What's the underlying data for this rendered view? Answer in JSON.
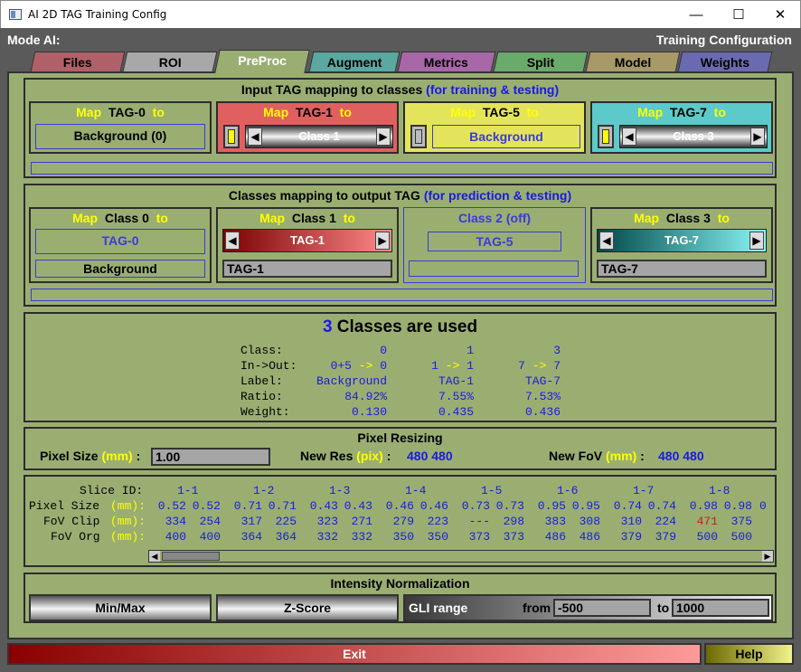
{
  "window": {
    "title": "AI 2D TAG Training Config",
    "min": "—",
    "max": "☐",
    "close": "✕"
  },
  "header": {
    "mode": "Mode AI:",
    "right": "Training Configuration"
  },
  "tabs": [
    {
      "label": "Files",
      "color": "#b06068"
    },
    {
      "label": "ROI",
      "color": "#a8a8a8"
    },
    {
      "label": "PreProc",
      "color": "#9aae72"
    },
    {
      "label": "Augment",
      "color": "#5aa8a0"
    },
    {
      "label": "Metrics",
      "color": "#a868a8"
    },
    {
      "label": "Split",
      "color": "#6aaa6a"
    },
    {
      "label": "Model",
      "color": "#a89a68"
    },
    {
      "label": "Weights",
      "color": "#6a6ab0"
    }
  ],
  "input_map": {
    "title": "Input TAG mapping to classes",
    "title_note": "(for training & testing)",
    "cells": [
      {
        "map": "Map",
        "tag": "TAG-0",
        "to": "to",
        "value": "Background (0)"
      },
      {
        "map": "Map",
        "tag": "TAG-1",
        "to": "to",
        "value": "Class 1"
      },
      {
        "map": "Map",
        "tag": "TAG-5",
        "to": "to",
        "value": "Background"
      },
      {
        "map": "Map",
        "tag": "TAG-7",
        "to": "to",
        "value": "Class 3"
      }
    ]
  },
  "output_map": {
    "title": "Classes mapping to output TAG",
    "title_note": "(for prediction & testing)",
    "cells": [
      {
        "map": "Map",
        "cls": "Class 0",
        "to": "to",
        "tag": "TAG-0",
        "label": "Background"
      },
      {
        "map": "Map",
        "cls": "Class 1",
        "to": "to",
        "tag": "TAG-1",
        "label": "TAG-1"
      },
      {
        "cls": "Class 2 (off)",
        "tag": "TAG-5",
        "label": ""
      },
      {
        "map": "Map",
        "cls": "Class 3",
        "to": "to",
        "tag": "TAG-7",
        "label": "TAG-7"
      }
    ]
  },
  "summary": {
    "count": "3",
    "count_text": "Classes are used",
    "row_labels": [
      "Class:",
      "In->Out:",
      "Label:",
      "Ratio:",
      "Weight:"
    ],
    "columns": [
      {
        "class": "0",
        "inout": "0+5 -> 0",
        "label": "Background",
        "ratio": "84.92%",
        "weight": "0.130"
      },
      {
        "class": "1",
        "inout": "1 -> 1",
        "label": "TAG-1",
        "ratio": "7.55%",
        "weight": "0.435"
      },
      {
        "class": "3",
        "inout": "7 -> 7",
        "label": "TAG-7",
        "ratio": "7.53%",
        "weight": "0.436"
      }
    ]
  },
  "resizing": {
    "title": "Pixel Resizing",
    "pixel_size_label": "Pixel Size",
    "mm": "(mm)",
    "colon": ":",
    "pixel_size_value": "1.00",
    "new_res_label": "New Res",
    "pix": "(pix)",
    "new_res_value": "480 480",
    "new_fov_label": "New FoV",
    "new_fov_value": "480 480"
  },
  "slices": {
    "row_labels": [
      "Slice ID:",
      "Pixel Size",
      "FoV Clip",
      "FoV Org"
    ],
    "mm": "(mm):",
    "ids": [
      "1-1",
      "1-2",
      "1-3",
      "1-4",
      "1-5",
      "1-6",
      "1-7",
      "1-8"
    ],
    "pixel_size": [
      [
        "0.52",
        "0.52"
      ],
      [
        "0.71",
        "0.71"
      ],
      [
        "0.43",
        "0.43"
      ],
      [
        "0.46",
        "0.46"
      ],
      [
        "0.73",
        "0.73"
      ],
      [
        "0.95",
        "0.95"
      ],
      [
        "0.74",
        "0.74"
      ],
      [
        "0.98",
        "0.98"
      ]
    ],
    "fov_clip": [
      [
        "334",
        "254"
      ],
      [
        "317",
        "225"
      ],
      [
        "323",
        "271"
      ],
      [
        "279",
        "223"
      ],
      [
        "---",
        "298"
      ],
      [
        "383",
        "308"
      ],
      [
        "310",
        "224"
      ],
      [
        "471",
        "375"
      ]
    ],
    "fov_org": [
      [
        "400",
        "400"
      ],
      [
        "364",
        "364"
      ],
      [
        "332",
        "332"
      ],
      [
        "350",
        "350"
      ],
      [
        "373",
        "373"
      ],
      [
        "486",
        "486"
      ],
      [
        "379",
        "379"
      ],
      [
        "500",
        "500"
      ]
    ],
    "trailing": "0",
    "warn_color": "#c02020"
  },
  "intensity": {
    "title": "Intensity Normalization",
    "minmax": "Min/Max",
    "zscore": "Z-Score",
    "gli": "GLI range",
    "from_label": "from",
    "from_value": "-500",
    "to_label": "to",
    "to_value": "1000"
  },
  "footer": {
    "exit": "Exit",
    "help": "Help"
  }
}
